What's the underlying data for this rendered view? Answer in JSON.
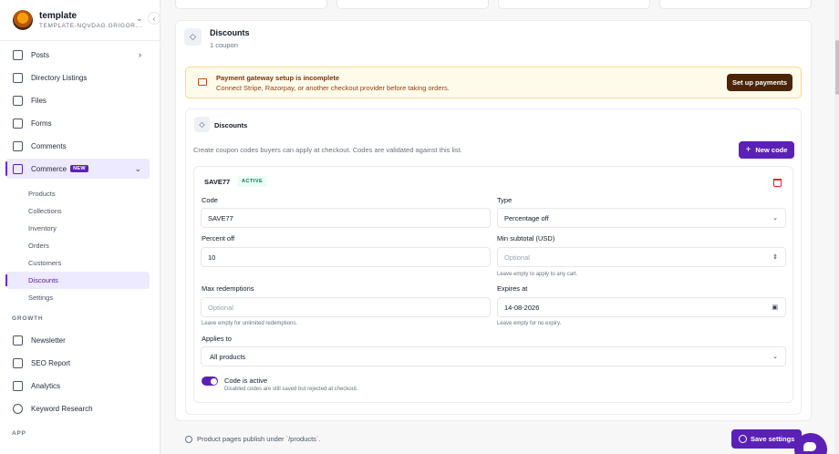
{
  "workspace": {
    "name": "template",
    "slug": "TEMPLATE-NQVDAG.GRIGOR..."
  },
  "sidebar": {
    "items": [
      {
        "label": "Posts"
      },
      {
        "label": "Directory Listings"
      },
      {
        "label": "Files"
      },
      {
        "label": "Forms"
      },
      {
        "label": "Comments"
      },
      {
        "label": "Commerce",
        "badge": "NEW"
      }
    ],
    "commerce_sub": [
      {
        "label": "Products"
      },
      {
        "label": "Collections"
      },
      {
        "label": "Inventory"
      },
      {
        "label": "Orders"
      },
      {
        "label": "Customers"
      },
      {
        "label": "Discounts"
      },
      {
        "label": "Settings"
      }
    ],
    "growth_heading": "GROWTH",
    "growth": [
      {
        "label": "Newsletter"
      },
      {
        "label": "SEO Report"
      },
      {
        "label": "Analytics"
      },
      {
        "label": "Keyword Research"
      }
    ],
    "app_heading": "APP"
  },
  "page": {
    "title": "Discounts",
    "subtitle": "1 coupon",
    "alert": {
      "title": "Payment gateway setup is incomplete",
      "description": "Connect Stripe, Razorpay, or another checkout provider before taking orders.",
      "button": "Set up payments"
    },
    "section_title": "Discounts",
    "section_desc": "Create coupon codes buyers can apply at checkout. Codes are validated against this list.",
    "new_code_button": "New code",
    "coupon": {
      "code_display": "SAVE77",
      "status": "ACTIVE",
      "code_label": "Code",
      "code_value": "SAVE77",
      "type_label": "Type",
      "type_value": "Percentage off",
      "percent_label": "Percent off",
      "percent_value": "10",
      "min_label": "Min subtotal (USD)",
      "min_placeholder": "Optional",
      "min_help": "Leave empty to apply to any cart.",
      "max_label": "Max redemptions",
      "max_placeholder": "Optional",
      "max_help": "Leave empty for unlimited redemptions.",
      "expires_label": "Expires at",
      "expires_value": "14-08-2026",
      "expires_help": "Leave empty for no expiry.",
      "applies_label": "Applies to",
      "applies_value": "All products",
      "active_label": "Code is active",
      "active_help": "Disabled codes are still saved but rejected at checkout."
    },
    "footer_note": "Product pages publish under `/products`.",
    "save_button": "Save settings"
  }
}
